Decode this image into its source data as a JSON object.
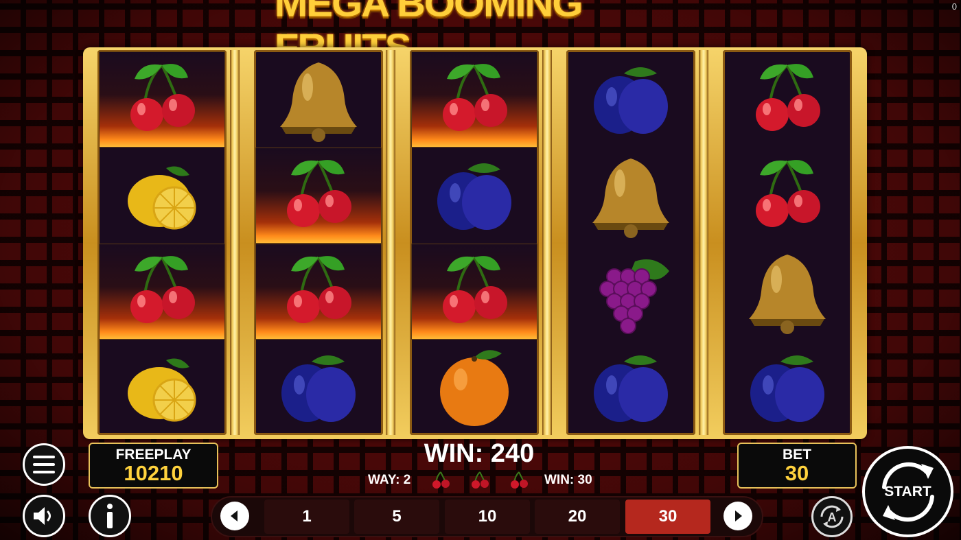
{
  "game": {
    "title": "MEGA BOOMING FRUITS",
    "corner_counter": "0"
  },
  "reels": [
    {
      "symbols": [
        "cherry-fire",
        "lemon",
        "cherry-fire",
        "lemon"
      ]
    },
    {
      "symbols": [
        "bell",
        "cherry-fire",
        "cherry-fire",
        "plum"
      ]
    },
    {
      "symbols": [
        "cherry-fire",
        "plum",
        "cherry-fire",
        "orange"
      ]
    },
    {
      "symbols": [
        "plum",
        "bell",
        "grapes",
        "plum"
      ]
    },
    {
      "symbols": [
        "cherry",
        "cherry",
        "bell",
        "plum"
      ]
    }
  ],
  "balance": {
    "label": "FREEPLAY",
    "value": "10210"
  },
  "bet": {
    "label": "BET",
    "value": "30"
  },
  "win": {
    "total": "WIN: 240",
    "way_label": "WAY: 2",
    "line_win": "WIN: 30",
    "line_symbols": [
      "cherry-icon",
      "cherry-icon",
      "cherry-icon"
    ]
  },
  "bet_options": {
    "values": [
      "1",
      "5",
      "10",
      "20",
      "30"
    ],
    "selected": "30"
  },
  "buttons": {
    "start": "START",
    "auto_icon": "autoplay-icon",
    "menu_icon": "hamburger-menu-icon",
    "sound_icon": "speaker-icon",
    "info_icon": "info-icon"
  },
  "colors": {
    "gold": "#ffcf3a",
    "selected_bet": "#b5281e",
    "reel_bg": "#1a0b1f"
  }
}
